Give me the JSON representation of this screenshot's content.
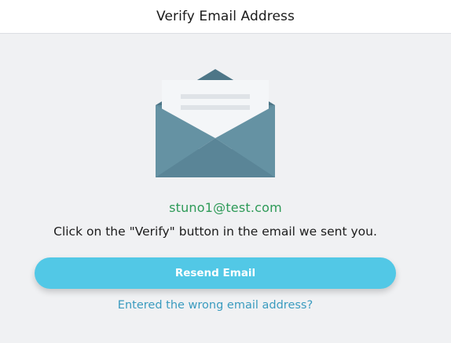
{
  "header": {
    "title": "Verify Email Address"
  },
  "main": {
    "email": "stuno1@test.com",
    "instruction": "Click on the \"Verify\" button in the email we sent you.",
    "resend_label": "Resend Email",
    "wrong_email_link": "Entered the wrong email address?"
  },
  "icons": {
    "illustration": "open-envelope-icon"
  },
  "colors": {
    "email_text": "#2d9a57",
    "button_bg": "#52c8e6",
    "link": "#3a9bbf",
    "envelope_body": "#6592a3",
    "envelope_dark": "#4d7687"
  }
}
